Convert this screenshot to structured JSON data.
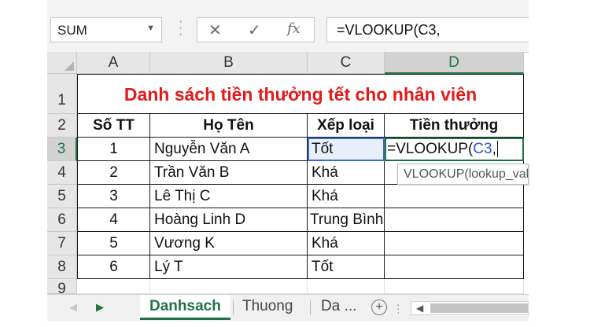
{
  "formula_bar": {
    "name_box": "SUM",
    "cancel_icon": "✕",
    "enter_icon": "✓",
    "fx_label": "fx",
    "formula": "=VLOOKUP(C3,"
  },
  "columns": [
    "A",
    "B",
    "C",
    "D"
  ],
  "rows": [
    "1",
    "2",
    "3",
    "4",
    "5",
    "6",
    "7",
    "8",
    "9"
  ],
  "title": "Danh sách tiền thưởng tết cho nhân viên",
  "headers": [
    "Số TT",
    "Họ Tên",
    "Xếp loại",
    "Tiền thưởng"
  ],
  "table": [
    {
      "stt": "1",
      "name": "Nguyễn Văn A",
      "rank": "Tốt"
    },
    {
      "stt": "2",
      "name": "Trần Văn B",
      "rank": "Khá"
    },
    {
      "stt": "3",
      "name": "Lê Thị C",
      "rank": "Khá"
    },
    {
      "stt": "4",
      "name": "Hoàng Linh D",
      "rank": "Trung Bình"
    },
    {
      "stt": "5",
      "name": "Vương K",
      "rank": "Khá"
    },
    {
      "stt": "6",
      "name": "Lý T",
      "rank": "Tốt"
    }
  ],
  "edit_cell": {
    "prefix": "=VLOOKUP(",
    "ref": "C3",
    "suffix": ","
  },
  "tooltip": "VLOOKUP(lookup_value, table_array, col_index_num, [range_lookup])",
  "sheets": {
    "active": "Danhsach",
    "other1": "Thuong",
    "other2": "Da ...",
    "prev": "◀",
    "next": "▶",
    "add": "+"
  },
  "colors": {
    "accent": "#217346",
    "title_red": "#e11b1b",
    "ref_blue": "#2b59c3"
  }
}
